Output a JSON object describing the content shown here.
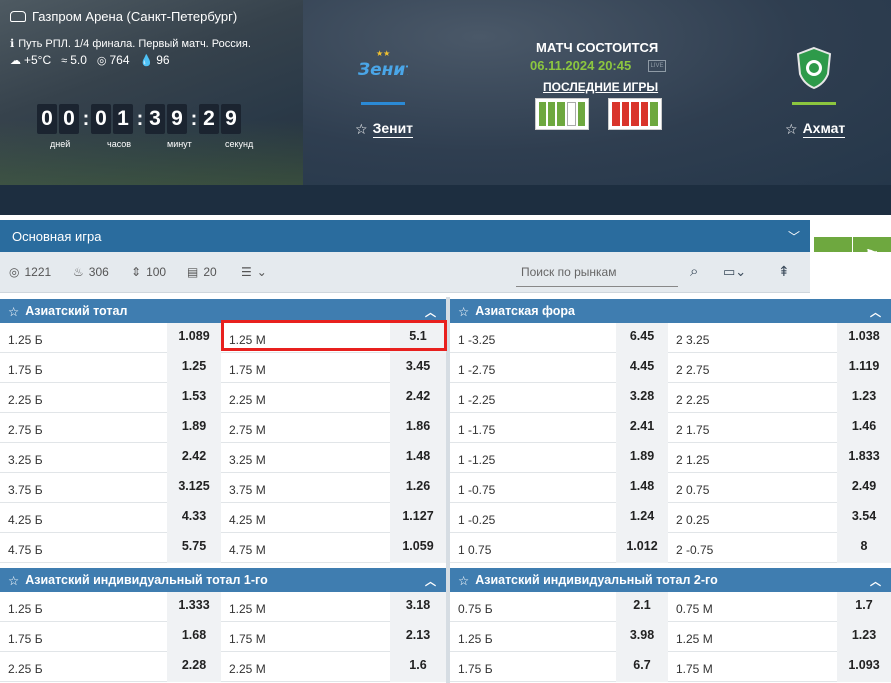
{
  "header": {
    "stadium": "Газпром Арена (Санкт-Петербург)",
    "tournament": "Путь РПЛ. 1/4 финала. Первый матч. Россия.",
    "weather": {
      "temp": "+5°C",
      "wind": "5.0",
      "pressure": "764",
      "humidity": "96"
    },
    "timer": {
      "digits": [
        "0",
        "0",
        "0",
        "1",
        "3",
        "9",
        "2",
        "9"
      ],
      "labels": [
        "дней",
        "часов",
        "минут",
        "секунд"
      ]
    },
    "home_team": "Зенит",
    "away_team": "Ахмат",
    "status": "МАТЧ СОСТОИТСЯ",
    "datetime": "06.11.2024 20:45",
    "last_games_label": "ПОСЛЕДНИЕ ИГРЫ",
    "home_form": [
      "#6ea83f",
      "#6ea83f",
      "#6ea83f",
      "#ffffff",
      "#6ea83f"
    ],
    "away_form": [
      "#d9342b",
      "#d9342b",
      "#d9342b",
      "#d9342b",
      "#6ea83f"
    ]
  },
  "market_bar": {
    "selected": "Основная игра",
    "stats": [
      {
        "icon": "target-icon",
        "value": "1221"
      },
      {
        "icon": "fire-icon",
        "value": "306"
      },
      {
        "icon": "up-down-icon",
        "value": "100"
      },
      {
        "icon": "bars-icon",
        "value": "20"
      }
    ],
    "search_placeholder": "Поиск по рынкам"
  },
  "blocks": {
    "asian_total": {
      "title": "Азиатский тотал",
      "rows": [
        [
          "1.25 Б",
          "1.089",
          "1.25 М",
          "5.1"
        ],
        [
          "1.75 Б",
          "1.25",
          "1.75 М",
          "3.45"
        ],
        [
          "2.25 Б",
          "1.53",
          "2.25 М",
          "2.42"
        ],
        [
          "2.75 Б",
          "1.89",
          "2.75 М",
          "1.86"
        ],
        [
          "3.25 Б",
          "2.42",
          "3.25 М",
          "1.48"
        ],
        [
          "3.75 Б",
          "3.125",
          "3.75 М",
          "1.26"
        ],
        [
          "4.25 Б",
          "4.33",
          "4.25 М",
          "1.127"
        ],
        [
          "4.75 Б",
          "5.75",
          "4.75 М",
          "1.059"
        ]
      ]
    },
    "asian_handicap": {
      "title": "Азиатская фора",
      "rows": [
        [
          "1 -3.25",
          "6.45",
          "2 3.25",
          "1.038"
        ],
        [
          "1 -2.75",
          "4.45",
          "2 2.75",
          "1.119"
        ],
        [
          "1 -2.25",
          "3.28",
          "2 2.25",
          "1.23"
        ],
        [
          "1 -1.75",
          "2.41",
          "2 1.75",
          "1.46"
        ],
        [
          "1 -1.25",
          "1.89",
          "2 1.25",
          "1.833"
        ],
        [
          "1 -0.75",
          "1.48",
          "2 0.75",
          "2.49"
        ],
        [
          "1 -0.25",
          "1.24",
          "2 0.25",
          "3.54"
        ],
        [
          "1 0.75",
          "1.012",
          "2 -0.75",
          "8"
        ]
      ]
    },
    "asian_ind_total_1": {
      "title": "Азиатский индивидуальный тотал 1-го",
      "rows": [
        [
          "1.25 Б",
          "1.333",
          "1.25 М",
          "3.18"
        ],
        [
          "1.75 Б",
          "1.68",
          "1.75 М",
          "2.13"
        ],
        [
          "2.25 Б",
          "2.28",
          "2.25 М",
          "1.6"
        ]
      ]
    },
    "asian_ind_total_2": {
      "title": "Азиатский индивидуальный тотал 2-го",
      "rows": [
        [
          "0.75 Б",
          "2.1",
          "0.75 М",
          "1.7"
        ],
        [
          "1.25 Б",
          "3.98",
          "1.25 М",
          "1.23"
        ],
        [
          "1.75 Б",
          "6.7",
          "1.75 М",
          "1.093"
        ]
      ]
    }
  }
}
